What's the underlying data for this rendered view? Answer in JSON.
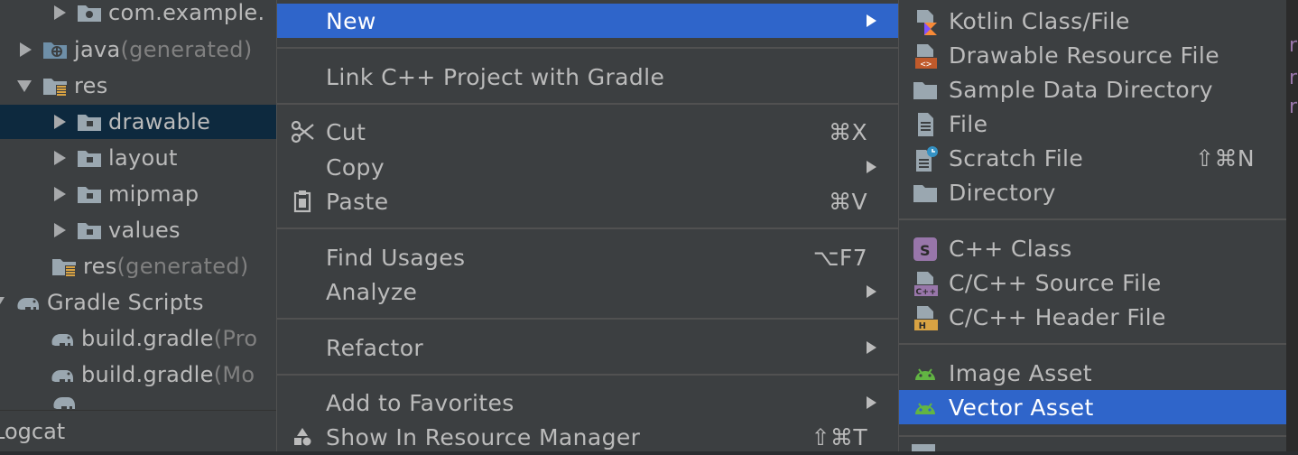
{
  "project_tree": {
    "items": [
      {
        "label": "com.example.",
        "suffix": ""
      },
      {
        "label": "java",
        "suffix": " (generated)"
      },
      {
        "label": "res",
        "suffix": ""
      },
      {
        "label": "drawable",
        "suffix": ""
      },
      {
        "label": "layout",
        "suffix": ""
      },
      {
        "label": "mipmap",
        "suffix": ""
      },
      {
        "label": "values",
        "suffix": ""
      },
      {
        "label": "res",
        "suffix": " (generated)"
      },
      {
        "label": "Gradle Scripts",
        "suffix": ""
      },
      {
        "label": "build.gradle",
        "suffix": " (Pro"
      },
      {
        "label": "build.gradle",
        "suffix": " (Mo"
      }
    ],
    "bottom_tab": "Logcat"
  },
  "context_menu": {
    "items": [
      {
        "label": "New",
        "shortcut": "",
        "icon": ""
      },
      {
        "label": "Link C++ Project with Gradle",
        "shortcut": "",
        "icon": ""
      },
      {
        "label": "Cut",
        "shortcut": "⌘X",
        "icon": "scissors-icon"
      },
      {
        "label": "Copy",
        "shortcut": "",
        "icon": ""
      },
      {
        "label": "Paste",
        "shortcut": "⌘V",
        "icon": "clipboard-icon"
      },
      {
        "label": "Find Usages",
        "shortcut": "⌥F7",
        "icon": ""
      },
      {
        "label": "Analyze",
        "shortcut": "",
        "icon": ""
      },
      {
        "label": "Refactor",
        "shortcut": "",
        "icon": ""
      },
      {
        "label": "Add to Favorites",
        "shortcut": "",
        "icon": ""
      },
      {
        "label": "Show In Resource Manager",
        "shortcut": "⇧⌘T",
        "icon": "resource-manager-icon"
      }
    ]
  },
  "submenu_new": {
    "items": [
      {
        "label": "Kotlin Class/File",
        "shortcut": "",
        "icon": "kotlin-file-icon"
      },
      {
        "label": "Drawable Resource File",
        "shortcut": "",
        "icon": "drawable-file-icon"
      },
      {
        "label": "Sample Data Directory",
        "shortcut": "",
        "icon": "folder-icon"
      },
      {
        "label": "File",
        "shortcut": "",
        "icon": "file-icon"
      },
      {
        "label": "Scratch File",
        "shortcut": "⇧⌘N",
        "icon": "scratch-file-icon"
      },
      {
        "label": "Directory",
        "shortcut": "",
        "icon": "folder-icon"
      },
      {
        "label": "C++ Class",
        "shortcut": "",
        "icon": "cpp-class-icon"
      },
      {
        "label": "C/C++ Source File",
        "shortcut": "",
        "icon": "cpp-source-file-icon"
      },
      {
        "label": "C/C++ Header File",
        "shortcut": "",
        "icon": "cpp-header-file-icon"
      },
      {
        "label": "Image Asset",
        "shortcut": "",
        "icon": "android-icon"
      },
      {
        "label": "Vector Asset",
        "shortcut": "",
        "icon": "android-icon"
      }
    ]
  },
  "colors": {
    "selection": "#2f65ca",
    "tree_selection": "#0d293e",
    "menu_bg": "#3c3f41",
    "text": "#bbbbbb",
    "android_green": "#62b543",
    "kotlin_orange": "#f88a37",
    "cpp_purple": "#9876aa",
    "header_orange": "#d9a343"
  }
}
